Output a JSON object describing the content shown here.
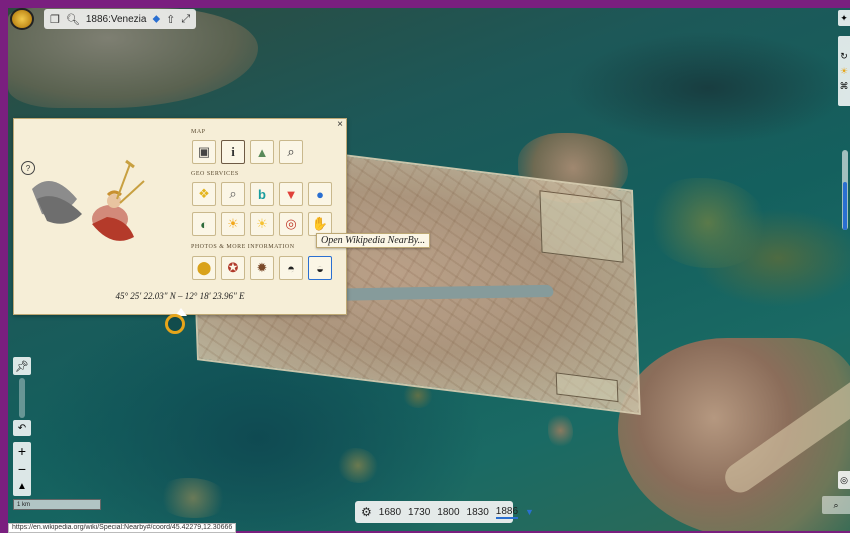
{
  "toolbar": {
    "layer_label": "1886:Venezia",
    "icons": [
      "layers-icon",
      "search-icon",
      "settings-icon",
      "share-icon",
      "fullscreen-icon"
    ]
  },
  "popup": {
    "sections": {
      "map": "MAP",
      "geo": "GEO SERVICES",
      "photos": "PHOTOS & MORE INFORMATION"
    },
    "coordinates": "45° 25' 22.03\" N – 12° 18' 23.96\" E",
    "tooltip": "Open Wikipedia NearBy...",
    "help": "?",
    "close": "×"
  },
  "timeline": {
    "years": [
      "1680",
      "1730",
      "1800",
      "1830",
      "1886"
    ],
    "active_year": "1886"
  },
  "scale_label": "1 km",
  "status_url": "https://en.wikipedia.org/wiki/Special:Nearby#/coord/45.42279,12.30666",
  "colors": {
    "frame": "#7a1f7f",
    "popup_bg": "#f6eed7",
    "accent": "#2a6fd1",
    "marker": "#e6a51a"
  }
}
